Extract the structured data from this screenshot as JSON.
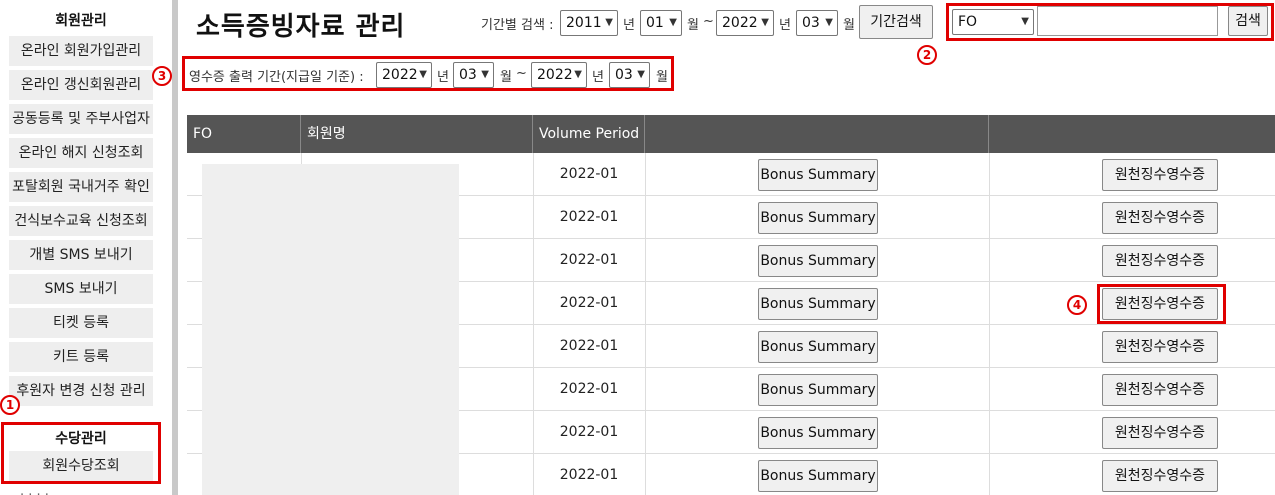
{
  "sidebar": {
    "member_header": "회원관리",
    "member_items": [
      "온라인 회원가입관리",
      "온라인 갱신회원관리",
      "공동등록 및 주부사업자",
      "온라인 해지 신청조회",
      "포탈회원 국내거주 확인",
      "건식보수교육 신청조회",
      "개별 SMS 보내기",
      "SMS 보내기",
      "티켓 등록",
      "키트 등록",
      "후원자 변경 신청 관리"
    ],
    "allowance_header": "수당관리",
    "allowance_items": [
      "회원수당조회"
    ]
  },
  "markers": {
    "m1": "1",
    "m2": "2",
    "m3": "3",
    "m4": "4"
  },
  "header": {
    "title": "소득증빙자료 관리",
    "period_search_label": "기간별 검색 :",
    "from_year": "2011",
    "from_month": "01",
    "to_year": "2022",
    "to_month": "03",
    "year_unit": "년",
    "month_unit": "월",
    "range_sep": "~",
    "period_search_button": "기간검색",
    "search_type": "FO",
    "search_value": "",
    "search_button": "검색"
  },
  "receipt_period": {
    "label": "영수증 출력 기간(지급일 기준) :",
    "from_year": "2022",
    "from_month": "03",
    "to_year": "2022",
    "to_month": "03"
  },
  "table": {
    "columns": [
      "FO",
      "회원명",
      "Volume Period",
      "",
      ""
    ],
    "rows": [
      {
        "period": "2022-01",
        "bonus": "Bonus Summary",
        "receipt": "원천징수영수증"
      },
      {
        "period": "2022-01",
        "bonus": "Bonus Summary",
        "receipt": "원천징수영수증"
      },
      {
        "period": "2022-01",
        "bonus": "Bonus Summary",
        "receipt": "원천징수영수증"
      },
      {
        "period": "2022-01",
        "bonus": "Bonus Summary",
        "receipt": "원천징수영수증"
      },
      {
        "period": "2022-01",
        "bonus": "Bonus Summary",
        "receipt": "원천징수영수증"
      },
      {
        "period": "2022-01",
        "bonus": "Bonus Summary",
        "receipt": "원천징수영수증"
      },
      {
        "period": "2022-01",
        "bonus": "Bonus Summary",
        "receipt": "원천징수영수증"
      },
      {
        "period": "2022-01",
        "bonus": "Bonus Summary",
        "receipt": "원천징수영수증"
      }
    ]
  },
  "colors": {
    "highlight": "#e00000",
    "table_header": "#555555",
    "sidebar_item": "#eeeeee"
  }
}
